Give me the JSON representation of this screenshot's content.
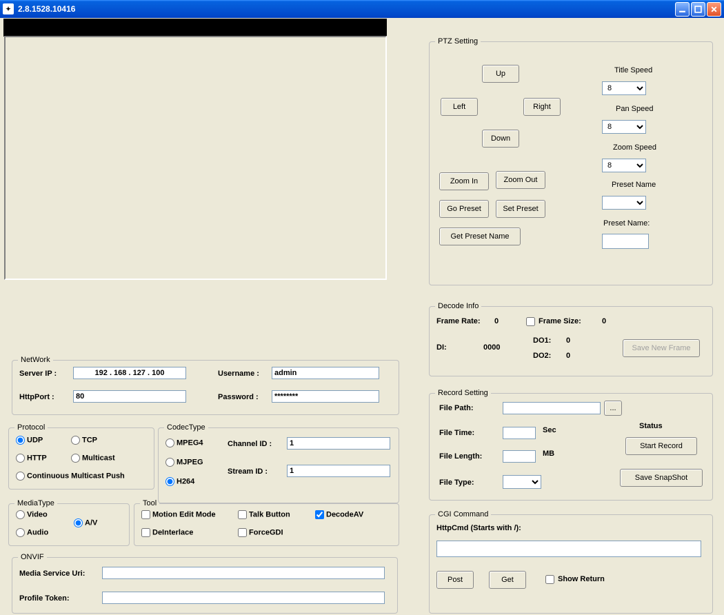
{
  "window": {
    "title": "2.8.1528.10416"
  },
  "ptz": {
    "legend": "PTZ Setting",
    "buttons": {
      "up": "Up",
      "left": "Left",
      "right": "Right",
      "down": "Down",
      "zoom_in": "Zoom In",
      "zoom_out": "Zoom Out",
      "go_preset": "Go Preset",
      "set_preset": "Set Preset",
      "get_preset_name": "Get Preset Name"
    },
    "labels": {
      "title_speed": "Title Speed",
      "pan_speed": "Pan Speed",
      "zoom_speed": "Zoom Speed",
      "preset_name": "Preset Name",
      "preset_name2": "Preset Name:"
    },
    "values": {
      "title_speed": "8",
      "pan_speed": "8",
      "zoom_speed": "8",
      "preset_name_sel": "",
      "preset_name_txt": ""
    }
  },
  "decode": {
    "legend": "Decode Info",
    "labels": {
      "frame_rate": "Frame Rate:",
      "frame_size": "Frame Size:",
      "di": "DI:",
      "do1": "DO1:",
      "do2": "DO2:"
    },
    "values": {
      "frame_rate": "0",
      "frame_size": "0",
      "di": "0000",
      "do1": "0",
      "do2": "0"
    },
    "save_btn": "Save New Frame"
  },
  "record": {
    "legend": "Record Setting",
    "labels": {
      "file_path": "File Path:",
      "file_time": "File Time:",
      "file_length": "File Length:",
      "file_type": "File Type:",
      "sec": "Sec",
      "mb": "MB",
      "status": "Status"
    },
    "browse": "...",
    "start": "Start Record",
    "snapshot": "Save SnapShot"
  },
  "cgi": {
    "legend": "CGI Command",
    "label": "HttpCmd (Starts with /):",
    "post": "Post",
    "get": "Get",
    "show_return": "Show Return"
  },
  "network": {
    "legend": "NetWork",
    "labels": {
      "server_ip": "Server IP :",
      "http_port": "HttpPort :",
      "username": "Username :",
      "password": "Password :"
    },
    "values": {
      "server_ip": "192 . 168 . 127 . 100",
      "http_port": "80",
      "username": "admin",
      "password": "********"
    }
  },
  "protocol": {
    "legend": "Protocol",
    "options": {
      "udp": "UDP",
      "tcp": "TCP",
      "http": "HTTP",
      "multicast": "Multicast",
      "cmp": "Continuous Multicast Push"
    }
  },
  "codec": {
    "legend": "CodecType",
    "options": {
      "mpeg4": "MPEG4",
      "mjpeg": "MJPEG",
      "h264": "H264"
    },
    "labels": {
      "channel": "Channel ID :",
      "stream": "Stream ID :"
    },
    "values": {
      "channel": "1",
      "stream": "1"
    }
  },
  "media": {
    "legend": "MediaType",
    "options": {
      "video": "Video",
      "audio": "Audio",
      "av": "A/V"
    }
  },
  "tool": {
    "legend": "Tool",
    "options": {
      "motion": "Motion Edit Mode",
      "talk": "Talk Button",
      "decodeav": "DecodeAV",
      "deint": "DeInterlace",
      "gdi": "ForceGDI"
    }
  },
  "onvif": {
    "legend": "ONVIF",
    "labels": {
      "uri": "Media Service Uri:",
      "token": "Profile Token:"
    }
  }
}
